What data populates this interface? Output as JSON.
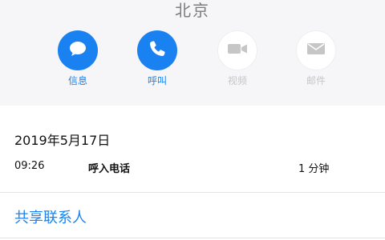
{
  "header": {
    "location": "北京"
  },
  "actions": [
    {
      "label": "信息",
      "icon": "message-icon",
      "state": "active"
    },
    {
      "label": "呼叫",
      "icon": "phone-icon",
      "state": "active"
    },
    {
      "label": "视频",
      "icon": "video-icon",
      "state": "disabled"
    },
    {
      "label": "邮件",
      "icon": "mail-icon",
      "state": "disabled"
    }
  ],
  "history": {
    "date": "2019年5月17日",
    "time": "09:26",
    "type": "呼入电话",
    "duration": "1 分钟"
  },
  "share_label": "共享联系人",
  "colors": {
    "accent": "#1a82f0",
    "disabled": "#c6c6c6",
    "header_bg": "#f6f6f8"
  }
}
